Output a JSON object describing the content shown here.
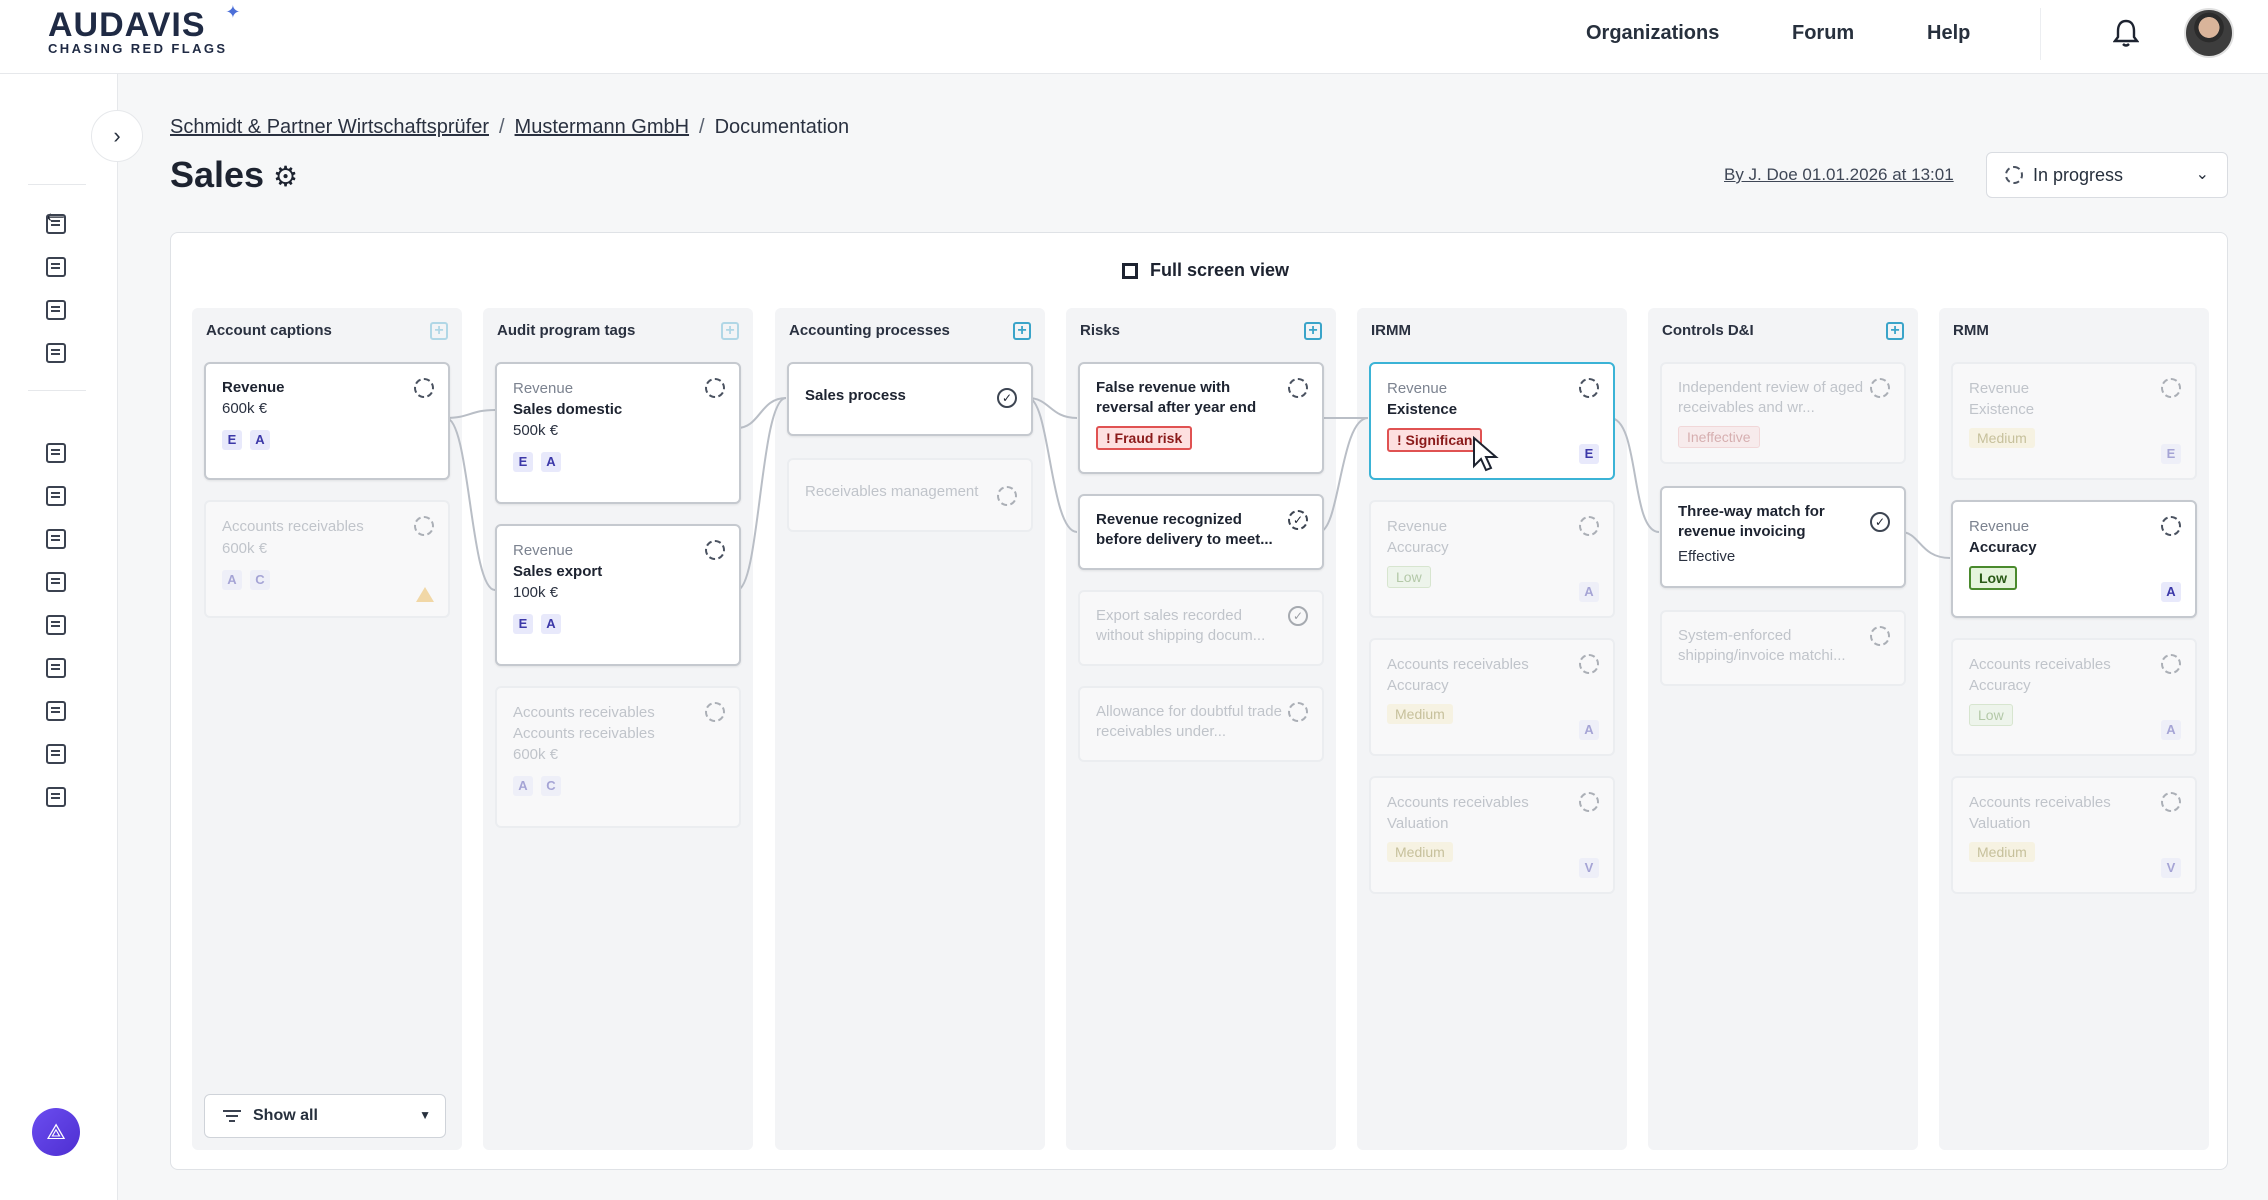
{
  "brand": {
    "name": "AUDAVIS",
    "tagline": "CHASING RED FLAGS"
  },
  "topnav": {
    "organizations": "Organizations",
    "forum": "Forum",
    "help": "Help"
  },
  "breadcrumb": {
    "org": "Schmidt & Partner Wirtschaftsprüfer",
    "client": "Mustermann GmbH",
    "current": "Documentation"
  },
  "page": {
    "title": "Sales",
    "byline": "By J. Doe 01.01.2026 at 13:01",
    "status": "In progress",
    "fullscreen": "Full screen view"
  },
  "columns": [
    {
      "title": "Account captions"
    },
    {
      "title": "Audit program tags"
    },
    {
      "title": "Accounting processes"
    },
    {
      "title": "Risks"
    },
    {
      "title": "IRMM"
    },
    {
      "title": "Controls D&I"
    },
    {
      "title": "RMM"
    }
  ],
  "cards": {
    "ac_revenue": {
      "main": "Revenue",
      "val": "600k €",
      "tags": [
        "E",
        "A"
      ]
    },
    "ac_receivables": {
      "top": "Accounts receivables",
      "val": "600k €",
      "tags": [
        "A",
        "C"
      ]
    },
    "apt_domestic": {
      "top": "Revenue",
      "main": "Sales domestic",
      "val": "500k €",
      "tags": [
        "E",
        "A"
      ]
    },
    "apt_export": {
      "top": "Revenue",
      "main": "Sales export",
      "val": "100k €",
      "tags": [
        "E",
        "A"
      ]
    },
    "apt_receivables": {
      "top": "Accounts receivables",
      "main": "Accounts receivables",
      "val": "600k €",
      "tags": [
        "A",
        "C"
      ]
    },
    "proc_sales": {
      "main": "Sales process"
    },
    "proc_receivables": {
      "main": "Receivables management"
    },
    "risk_false": {
      "main": "False revenue with reversal after year end",
      "pill": "! Fraud risk"
    },
    "risk_recognized": {
      "main": "Revenue recognized before delivery to meet..."
    },
    "risk_export": {
      "main": "Export sales recorded without shipping docum..."
    },
    "risk_allowance": {
      "main": "Allowance for doubtful trade receivables under..."
    },
    "irmm_existence": {
      "top": "Revenue",
      "main": "Existence",
      "pill": "! Significan",
      "tag": "E"
    },
    "irmm_accuracy": {
      "top": "Revenue",
      "main": "Accuracy",
      "pill": "Low",
      "tag": "A"
    },
    "irmm_ar_accuracy": {
      "top": "Accounts receivables",
      "main": "Accuracy",
      "pill": "Medium",
      "tag": "A"
    },
    "irmm_ar_valuation": {
      "top": "Accounts receivables",
      "main": "Valuation",
      "pill": "Medium",
      "tag": "V"
    },
    "ctrl_independent": {
      "main": "Independent review of aged receivables and wr...",
      "pill": "Ineffective"
    },
    "ctrl_threeway": {
      "main": "Three-way match for revenue invoicing",
      "val": "Effective"
    },
    "ctrl_system": {
      "main": "System-enforced shipping/invoice matchi..."
    },
    "rmm_existence": {
      "top": "Revenue",
      "main": "Existence",
      "pill": "Medium",
      "tag": "E"
    },
    "rmm_accuracy": {
      "top": "Revenue",
      "main": "Accuracy",
      "pill": "Low",
      "tag": "A"
    },
    "rmm_ar_accuracy": {
      "top": "Accounts receivables",
      "main": "Accuracy",
      "pill": "Low",
      "tag": "A"
    },
    "rmm_ar_valuation": {
      "top": "Accounts receivables",
      "main": "Valuation",
      "pill": "Medium",
      "tag": "V"
    }
  },
  "filter": {
    "label": "Show all"
  },
  "colors": {
    "accent": "#3bb3d6",
    "fraud": "#e05252",
    "low": "#4a8a2d",
    "tag_bg": "#e8e9fb"
  }
}
